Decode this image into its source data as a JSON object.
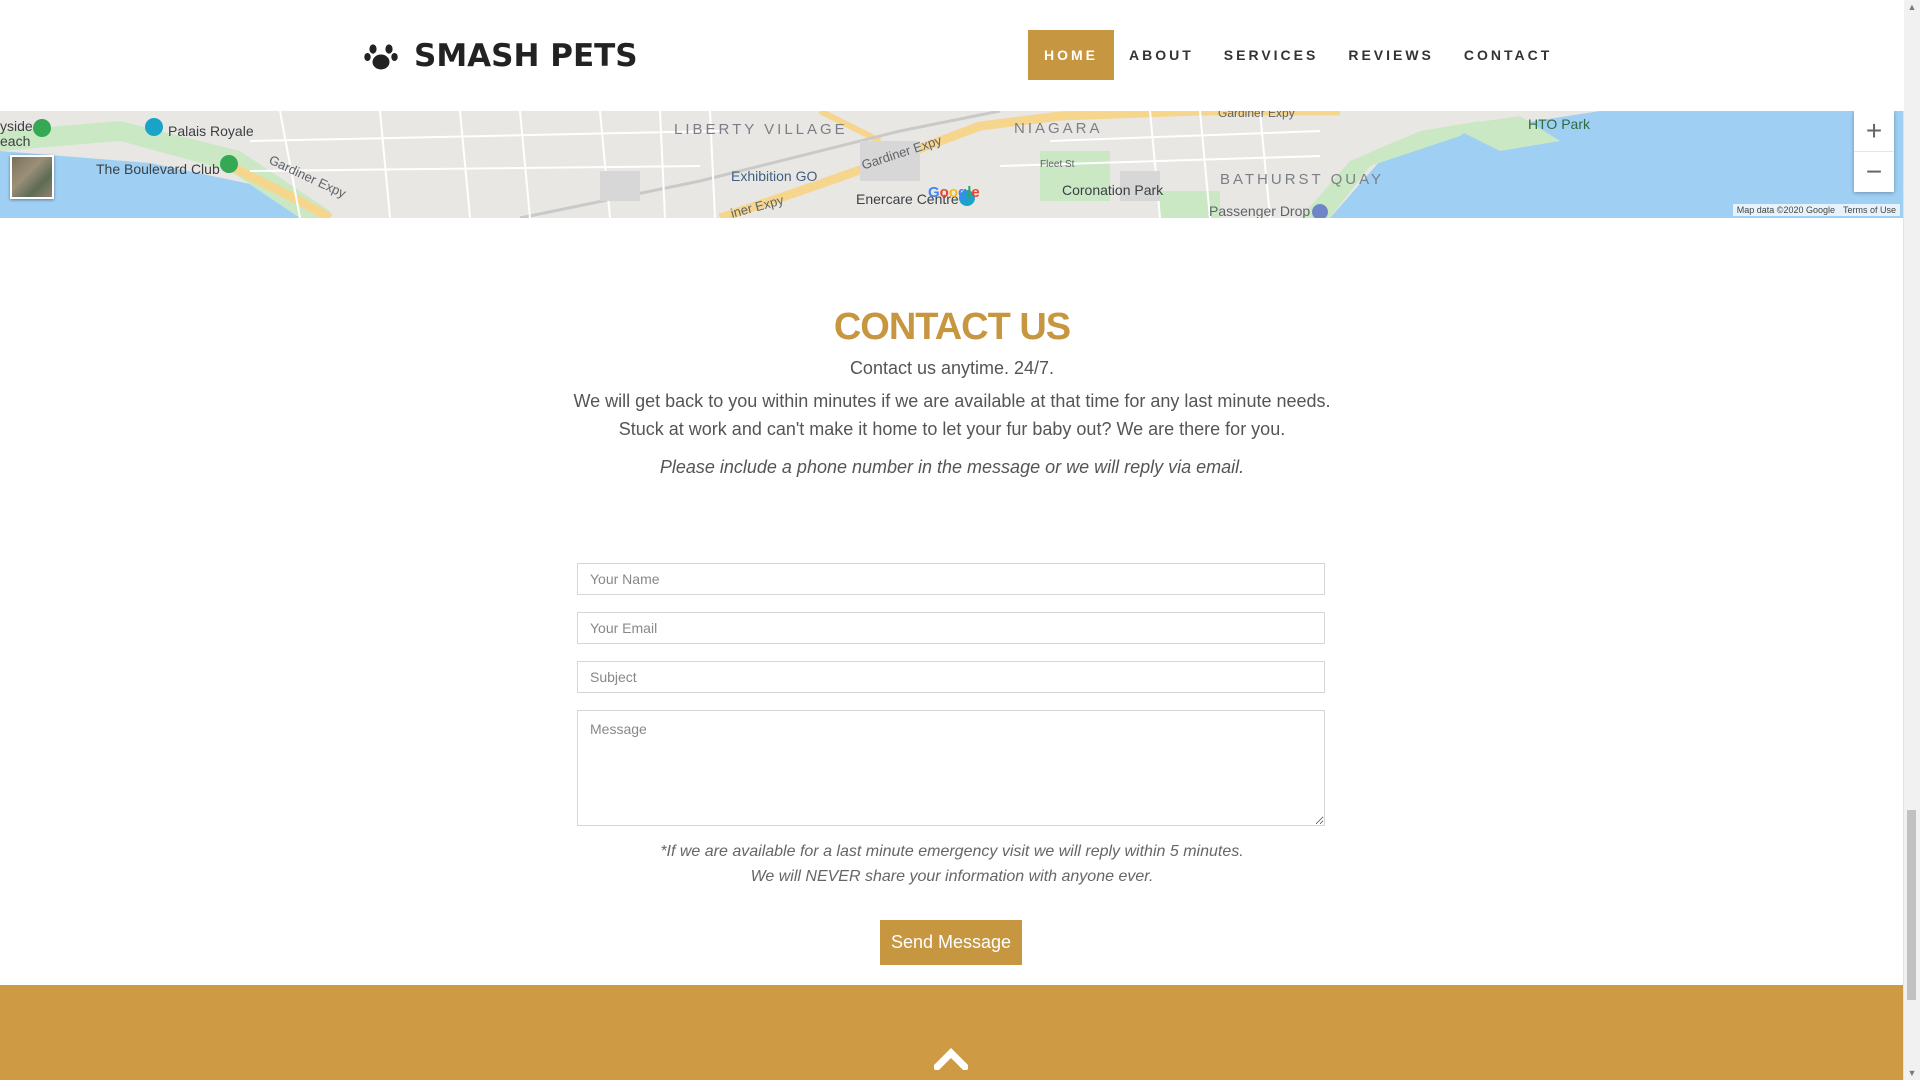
{
  "brand": {
    "name": "SMASH PETS",
    "icon": "paw-icon"
  },
  "nav": {
    "items": [
      {
        "label": "HOME",
        "active": true
      },
      {
        "label": "ABOUT",
        "active": false
      },
      {
        "label": "SERVICES",
        "active": false
      },
      {
        "label": "REVIEWS",
        "active": false
      },
      {
        "label": "CONTACT",
        "active": false
      }
    ]
  },
  "map": {
    "labels": {
      "ysideach": "yside\neach",
      "palais": "Palais Royale",
      "boulevard": "The Boulevard Club",
      "gardiner_left": "Gardiner Expy",
      "liberty": "LIBERTY VILLAGE",
      "exhibition": "Exhibition GO",
      "gardiner_mid": "Gardiner Expy",
      "gardiner_low": "iner Expy",
      "enercare": "Enercare Centre",
      "niagara": "NIAGARA",
      "fleet": "Fleet St",
      "coronation": "Coronation Park",
      "bathurst": "BATHURST QUAY",
      "passenger": "Passenger Drop",
      "gardiner_top": "Gardiner Expy",
      "hto": "HTO Park",
      "google": "Google"
    },
    "zoom_in": "+",
    "zoom_out": "−",
    "attribution": "Map data ©2020 Google",
    "terms": "Terms of Use"
  },
  "contact": {
    "title": "CONTACT US",
    "line1": "Contact us anytime. 24/7.",
    "line2": "We will get back to you within minutes if we are available at that time for any last minute needs.",
    "line3": "Stuck at work and can't make it home to let your fur baby out? We are there for you.",
    "line4": "Please include a phone number in the message or we will reply via email."
  },
  "form": {
    "name_placeholder": "Your Name",
    "email_placeholder": "Your Email",
    "subject_placeholder": "Subject",
    "message_placeholder": "Message",
    "note1": "*If we are available for a last minute emergency visit we will reply within 5 minutes.",
    "note2": "We will NEVER share your information with anyone ever.",
    "submit_label": "Send Message"
  },
  "colors": {
    "accent": "#c79641",
    "footer": "#cf9a44",
    "water": "#9fd0f3",
    "park": "#cbe8c5",
    "road": "#f6d58c"
  }
}
